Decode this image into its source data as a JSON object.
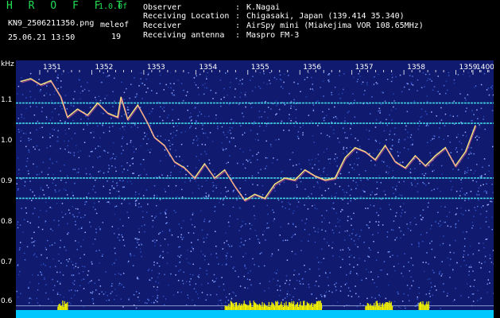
{
  "header": {
    "app_title": "H R O F F T",
    "version": "1.0.0f",
    "filename": "KN9_2506211350.png",
    "mode": "meleof",
    "datetime": "25.06.21 13:50",
    "count": "19",
    "info": [
      {
        "label": "Observer",
        "value": "K.Nagai"
      },
      {
        "label": "Receiving Location",
        "value": "Chigasaki, Japan (139.414 35.340)"
      },
      {
        "label": "Receiver",
        "value": "AirSpy mini (Miakejima VOR 108.65MHz)"
      },
      {
        "label": "Receiving antenna",
        "value": "Maspro FM-3"
      }
    ],
    "separator": ":"
  },
  "plot": {
    "y_unit": "kHz",
    "y_ticks": [
      "1.1",
      "1.0",
      "0.9",
      "0.8",
      "0.7",
      "0.6"
    ],
    "x_ticks": [
      "1351",
      "1352",
      "1353",
      "1354",
      "1355",
      "1356",
      "1357",
      "1358",
      "1359",
      "1400"
    ],
    "colors": {
      "background": "#101a6e",
      "carrier": "#40d0e0",
      "trace": "#f0e080",
      "baseline": "#00c8ff",
      "burst": "#f0f000",
      "tick": "#ffffff"
    },
    "carrier_lines_khz": [
      1.115,
      1.065,
      0.93,
      0.88
    ],
    "trace_khz": [
      [
        0.0,
        1.168
      ],
      [
        0.03,
        1.175
      ],
      [
        0.06,
        1.16
      ],
      [
        0.09,
        1.17
      ],
      [
        0.12,
        1.13
      ],
      [
        0.14,
        1.08
      ],
      [
        0.17,
        1.1
      ],
      [
        0.2,
        1.085
      ],
      [
        0.23,
        1.115
      ],
      [
        0.26,
        1.09
      ],
      [
        0.29,
        1.08
      ],
      [
        0.3,
        1.13
      ],
      [
        0.32,
        1.075
      ],
      [
        0.35,
        1.11
      ],
      [
        0.38,
        1.065
      ],
      [
        0.4,
        1.03
      ],
      [
        0.43,
        1.01
      ],
      [
        0.46,
        0.97
      ],
      [
        0.49,
        0.955
      ],
      [
        0.52,
        0.93
      ],
      [
        0.55,
        0.965
      ],
      [
        0.58,
        0.93
      ],
      [
        0.61,
        0.95
      ],
      [
        0.64,
        0.91
      ],
      [
        0.67,
        0.875
      ],
      [
        0.7,
        0.89
      ],
      [
        0.73,
        0.88
      ],
      [
        0.76,
        0.915
      ],
      [
        0.79,
        0.93
      ],
      [
        0.82,
        0.925
      ],
      [
        0.85,
        0.95
      ],
      [
        0.88,
        0.935
      ],
      [
        0.91,
        0.925
      ],
      [
        0.94,
        0.93
      ],
      [
        0.97,
        0.98
      ],
      [
        1.0,
        1.005
      ],
      [
        1.03,
        0.995
      ],
      [
        1.06,
        0.975
      ],
      [
        1.09,
        1.01
      ],
      [
        1.12,
        0.97
      ],
      [
        1.15,
        0.955
      ],
      [
        1.18,
        0.985
      ],
      [
        1.21,
        0.96
      ],
      [
        1.24,
        0.985
      ],
      [
        1.27,
        1.005
      ],
      [
        1.3,
        0.96
      ],
      [
        1.33,
        0.995
      ],
      [
        1.36,
        1.06
      ]
    ],
    "bursts": [
      {
        "start": 0.61,
        "end": 0.9
      },
      {
        "start": 1.03,
        "end": 1.11
      },
      {
        "start": 1.19,
        "end": 1.22
      },
      {
        "start": 0.11,
        "end": 0.14
      }
    ]
  }
}
